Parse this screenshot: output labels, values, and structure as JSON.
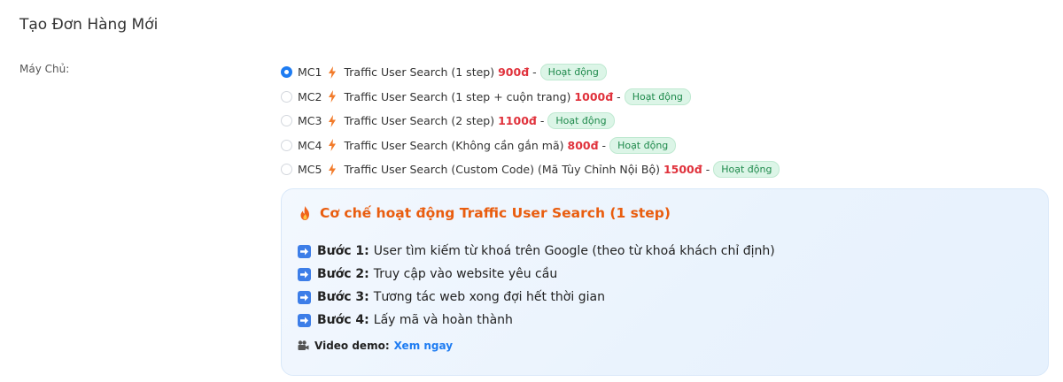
{
  "page": {
    "title": "Tạo Đơn Hàng Mới"
  },
  "server": {
    "label": "Máy Chủ:",
    "options": [
      {
        "code": "MC1",
        "name": "Traffic User Search (1 step)",
        "price": "900đ",
        "dash": "-",
        "status": "Hoạt động",
        "checked": true
      },
      {
        "code": "MC2",
        "name": "Traffic User Search (1 step + cuộn trang)",
        "price": "1000đ",
        "dash": "-",
        "status": "Hoạt động",
        "checked": false
      },
      {
        "code": "MC3",
        "name": "Traffic User Search (2 step)",
        "price": "1100đ",
        "dash": "-",
        "status": "Hoạt động",
        "checked": false
      },
      {
        "code": "MC4",
        "name": "Traffic User Search (Không cần gắn mã)",
        "price": "800đ",
        "dash": "-",
        "status": "Hoạt động",
        "checked": false
      },
      {
        "code": "MC5",
        "name": "Traffic User Search (Custom Code) (Mã Tùy Chỉnh Nội Bộ)",
        "price": "1500đ",
        "dash": "-",
        "status": "Hoạt động",
        "checked": false
      }
    ]
  },
  "info": {
    "title": "Cơ chế hoạt động Traffic User Search (1 step)",
    "steps": [
      {
        "label": "Bước 1:",
        "text": "User tìm kiếm từ khoá trên Google (theo từ khoá khách chỉ định)"
      },
      {
        "label": "Bước 2:",
        "text": "Truy cập vào website yêu cầu"
      },
      {
        "label": "Bước 3:",
        "text": "Tương tác web xong đợi hết thời gian"
      },
      {
        "label": "Bước 4:",
        "text": "Lấy mã và hoàn thành"
      }
    ],
    "video_label": "Video demo:",
    "video_link": "Xem ngay"
  },
  "colors": {
    "accent": "#1e7cf2",
    "price": "#e0323c",
    "badge_bg": "#dcf5e7",
    "badge_text": "#1f8a4c",
    "card_title": "#e95d0f"
  },
  "icons": {
    "bolt": "bolt-icon",
    "fire": "fire-icon",
    "arrow": "arrow-right-icon",
    "camera": "movie-camera-icon"
  }
}
